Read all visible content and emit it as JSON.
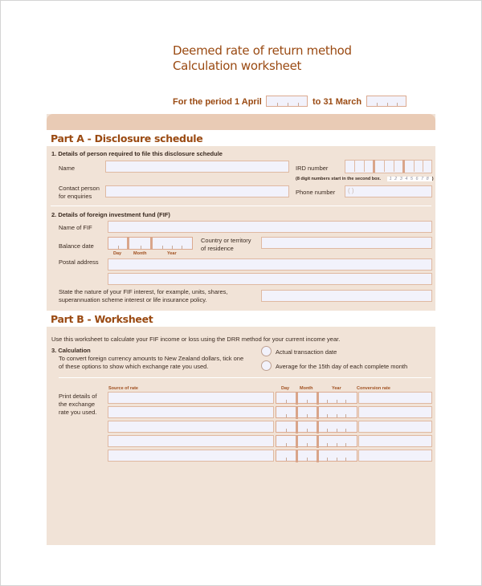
{
  "header": {
    "title_line1": "Deemed rate of return method",
    "title_line2": "Calculation worksheet",
    "period_from_label": "For the period 1 April",
    "period_to_label": "to 31 March"
  },
  "part_a": {
    "title": "Part A - Disclosure schedule",
    "section1": {
      "heading": "1. Details of person required to file this disclosure schedule",
      "name_label": "Name",
      "contact_label_line1": "Contact person",
      "contact_label_line2": "for enquiries",
      "ird_label": "IRD number",
      "ird_note": "(8 digit numbers start in the second box.",
      "ird_note_example": "1 2 3 4 5 6 7 8",
      "ird_note_close": ")",
      "phone_label": "Phone number",
      "phone_placeholder": "( )"
    },
    "section2": {
      "heading": "2. Details of foreign investment fund (FIF)",
      "name_fif_label": "Name of FIF",
      "balance_date_label": "Balance date",
      "date_sublabels": {
        "day": "Day",
        "month": "Month",
        "year": "Year"
      },
      "country_label_line1": "Country or territory",
      "country_label_line2": "of residence",
      "postal_label": "Postal address",
      "nature_line1": "State the nature of your FIF interest, for example, units, shares,",
      "nature_line2": "superannuation scheme interest or life insurance policy."
    }
  },
  "part_b": {
    "title": "Part B - Worksheet",
    "intro": "Use this worksheet to calculate your FIF income or loss using the DRR method for your current income year.",
    "section3": {
      "heading": "3. Calculation",
      "desc_line1": "To convert foreign currency amounts to New Zealand dollars, tick one",
      "desc_line2": "of these options to show which exchange rate you used.",
      "options": [
        {
          "label": "Actual transaction date",
          "selected": false
        },
        {
          "label": "Average for the 15th day of each complete month",
          "selected": false
        }
      ]
    },
    "rate_table": {
      "side_label_line1": "Print details of",
      "side_label_line2": "the exchange",
      "side_label_line3": "rate you used.",
      "columns": [
        "Source of rate",
        "Day",
        "Month",
        "Year",
        "Conversion rate"
      ],
      "row_count": 5
    }
  }
}
